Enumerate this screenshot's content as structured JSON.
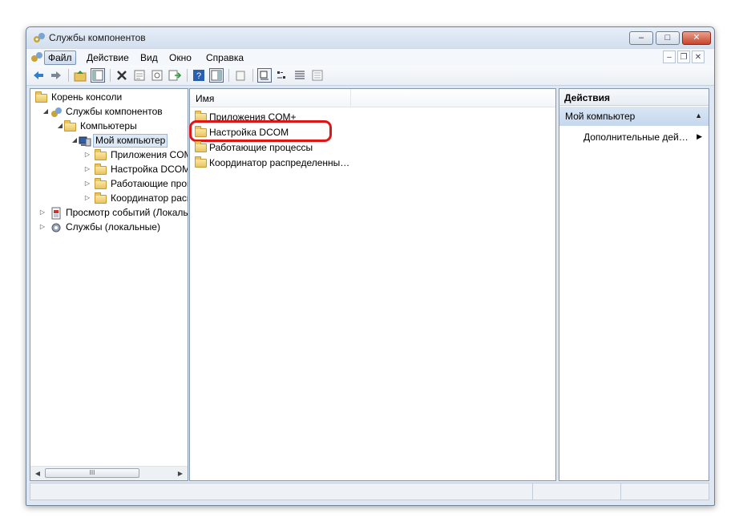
{
  "window": {
    "title": "Службы компонентов",
    "icon": "component-services-icon",
    "controls": {
      "minimize": "–",
      "maximize": "□",
      "close": "✕"
    }
  },
  "menu": {
    "items": [
      "Файл",
      "Действие",
      "Вид",
      "Окно",
      "Справка"
    ],
    "active": "Файл",
    "mdi_controls": {
      "minimize": "–",
      "restore": "❐",
      "close": "✕"
    }
  },
  "toolbar": {
    "buttons": [
      "back-icon",
      "forward-icon",
      "up-folder-icon",
      "show-hide-tree-icon",
      "delete-icon",
      "properties-icon",
      "refresh-icon",
      "export-list-icon",
      "help-icon",
      "action-pane-icon",
      "new-window-icon",
      "large-icons-view-icon",
      "small-icons-view-icon",
      "list-view-icon",
      "details-view-icon"
    ]
  },
  "tree": {
    "items": [
      {
        "label": "Корень консоли",
        "icon": "folder-icon",
        "level": 0,
        "expander": ""
      },
      {
        "label": "Службы компонентов",
        "icon": "component-services-icon",
        "level": 1,
        "expander": "◢"
      },
      {
        "label": "Компьютеры",
        "icon": "folder-icon",
        "level": 2,
        "expander": "◢"
      },
      {
        "label": "Мой компьютер",
        "icon": "computer-icon",
        "level": 3,
        "expander": "◢",
        "selected": true
      },
      {
        "label": "Приложения COM+",
        "icon": "folder-icon",
        "level": 4,
        "expander": "▷"
      },
      {
        "label": "Настройка DCOM",
        "icon": "folder-icon",
        "level": 4,
        "expander": "▷"
      },
      {
        "label": "Работающие процессы",
        "icon": "folder-icon",
        "level": 4,
        "expander": "▷"
      },
      {
        "label": "Координатор распределенных транзакций",
        "icon": "folder-icon",
        "level": 4,
        "expander": "▷"
      },
      {
        "label": "Просмотр событий (Локальный)",
        "icon": "event-viewer-icon",
        "level": 1,
        "expander": "▷"
      },
      {
        "label": "Службы (локальные)",
        "icon": "services-gear-icon",
        "level": 1,
        "expander": "▷"
      }
    ],
    "scroll": {
      "left": "◀",
      "right": "▶",
      "grip": "III"
    }
  },
  "list": {
    "column_header": "Имя",
    "rows": [
      {
        "label": "Приложения COM+",
        "icon": "folder-icon"
      },
      {
        "label": "Настройка DCOM",
        "icon": "folder-icon",
        "highlighted": true
      },
      {
        "label": "Работающие процессы",
        "icon": "folder-icon"
      },
      {
        "label": "Координатор распределенны…",
        "icon": "folder-icon"
      }
    ]
  },
  "actions": {
    "header": "Действия",
    "section": "Мой компьютер",
    "section_caret": "▲",
    "link": "Дополнительные дей…",
    "link_arrow": "▶"
  },
  "colors": {
    "highlight_ring": "#e01616",
    "selection": "#dce8f6",
    "window_frame": "#dfe8f2"
  }
}
